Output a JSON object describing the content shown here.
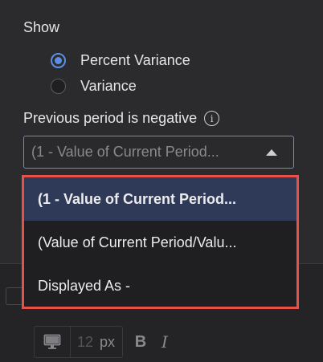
{
  "show": {
    "label": "Show",
    "options": [
      {
        "label": "Percent Variance",
        "checked": true
      },
      {
        "label": "Variance",
        "checked": false
      }
    ]
  },
  "previous_period": {
    "label": "Previous period is negative",
    "info_icon": "info-icon",
    "selected_value": "(1 - Value of Current Period..."
  },
  "dropdown": {
    "options": [
      "(1 - Value of Current Period...",
      "(Value of Current Period/Valu...",
      "Displayed As -"
    ],
    "highlight_color": "#e8504a",
    "selected_bg": "#2f3a58"
  },
  "toolbar": {
    "device_icon": "monitor-icon",
    "font_size_value": "12",
    "font_size_unit": "px",
    "bold_label": "B",
    "italic_label": "I"
  },
  "colors": {
    "accent": "#5c8fe0",
    "panel_bg": "#2b2b2d"
  }
}
